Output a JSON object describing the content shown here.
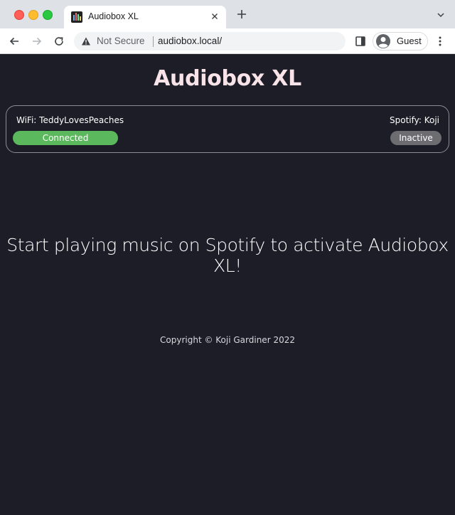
{
  "browser": {
    "tab": {
      "title": "Audiobox XL",
      "favicon": "audio-bars-icon",
      "close_icon": "close-icon"
    },
    "new_tab_icon": "plus-icon",
    "tab_menu_icon": "chevron-down-icon",
    "nav": {
      "back_icon": "back-arrow-icon",
      "forward_icon": "forward-arrow-icon",
      "reload_icon": "reload-icon"
    },
    "omnibox": {
      "security_icon": "warning-triangle-icon",
      "security_text": "Not Secure",
      "url": "audiobox.local/"
    },
    "side_panel_icon": "side-panel-icon",
    "profile": {
      "avatar_icon": "guest-avatar-icon",
      "label": "Guest"
    },
    "menu_icon": "kebab-menu-icon"
  },
  "page": {
    "title": "Audiobox XL",
    "status": {
      "wifi_label": "WiFi: TeddyLovesPeaches",
      "wifi_state": "Connected",
      "spotify_label": "Spotify: Koji",
      "spotify_state": "Inactive"
    },
    "prompt": "Start playing music on Spotify to activate Audiobox XL!",
    "copyright": "Copyright © Koji Gardiner 2022"
  },
  "colors": {
    "background": "#1d1d28",
    "title": "#f8e4e8",
    "connected": "#5cb85c",
    "inactive": "#6c6c71",
    "panel_border": "#8c8c97"
  }
}
